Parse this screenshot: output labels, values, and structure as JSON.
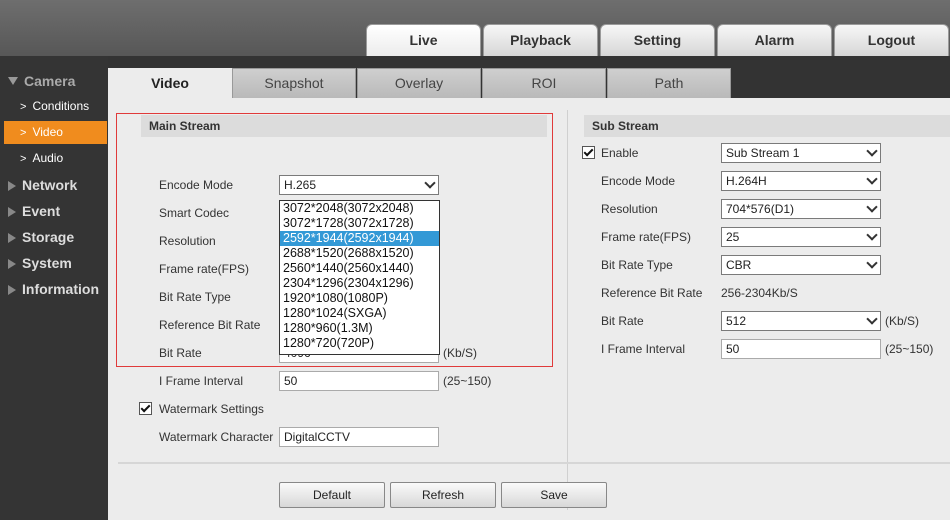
{
  "top_tabs": [
    "Live",
    "Playback",
    "Setting",
    "Alarm",
    "Logout"
  ],
  "sidebar": {
    "camera": "Camera",
    "items": [
      "Conditions",
      "Video",
      "Audio"
    ],
    "sections": [
      "Network",
      "Event",
      "Storage",
      "System",
      "Information"
    ]
  },
  "sub_tabs": [
    "Video",
    "Snapshot",
    "Overlay",
    "ROI",
    "Path"
  ],
  "main": {
    "title": "Main Stream",
    "encode_mode_label": "Encode Mode",
    "encode_mode_value": "H.265",
    "smart_codec_label": "Smart Codec",
    "resolution_label": "Resolution",
    "frame_rate_label": "Frame rate(FPS)",
    "bit_rate_type_label": "Bit Rate Type",
    "ref_bit_rate_label": "Reference Bit Rate",
    "bit_rate_label": "Bit Rate",
    "bit_rate_value": "4096",
    "bit_rate_unit": "(Kb/S)",
    "iframe_label": "I Frame Interval",
    "iframe_value": "50",
    "iframe_range": "(25~150)",
    "watermark_settings_label": "Watermark Settings",
    "watermark_char_label": "Watermark Character",
    "watermark_char_value": "DigitalCCTV",
    "resolution_options": [
      "3072*2048(3072x2048)",
      "3072*1728(3072x1728)",
      "2592*1944(2592x1944)",
      "2688*1520(2688x1520)",
      "2560*1440(2560x1440)",
      "2304*1296(2304x1296)",
      "1920*1080(1080P)",
      "1280*1024(SXGA)",
      "1280*960(1.3M)",
      "1280*720(720P)"
    ],
    "resolution_selected_index": 2
  },
  "sub": {
    "title": "Sub Stream",
    "enable_label": "Enable",
    "stream_value": "Sub Stream 1",
    "encode_mode_label": "Encode Mode",
    "encode_mode_value": "H.264H",
    "resolution_label": "Resolution",
    "resolution_value": "704*576(D1)",
    "frame_rate_label": "Frame rate(FPS)",
    "frame_rate_value": "25",
    "bit_rate_type_label": "Bit Rate Type",
    "bit_rate_type_value": "CBR",
    "ref_bit_rate_label": "Reference Bit Rate",
    "ref_bit_rate_value": "256-2304Kb/S",
    "bit_rate_label": "Bit Rate",
    "bit_rate_value": "512",
    "bit_rate_unit": "(Kb/S)",
    "iframe_label": "I Frame Interval",
    "iframe_value": "50",
    "iframe_range": "(25~150)"
  },
  "buttons": {
    "default": "Default",
    "refresh": "Refresh",
    "save": "Save"
  },
  "colors": {
    "accent": "#f08c1e",
    "highlight": "#3399d6",
    "annotation": "#e03a3a"
  }
}
